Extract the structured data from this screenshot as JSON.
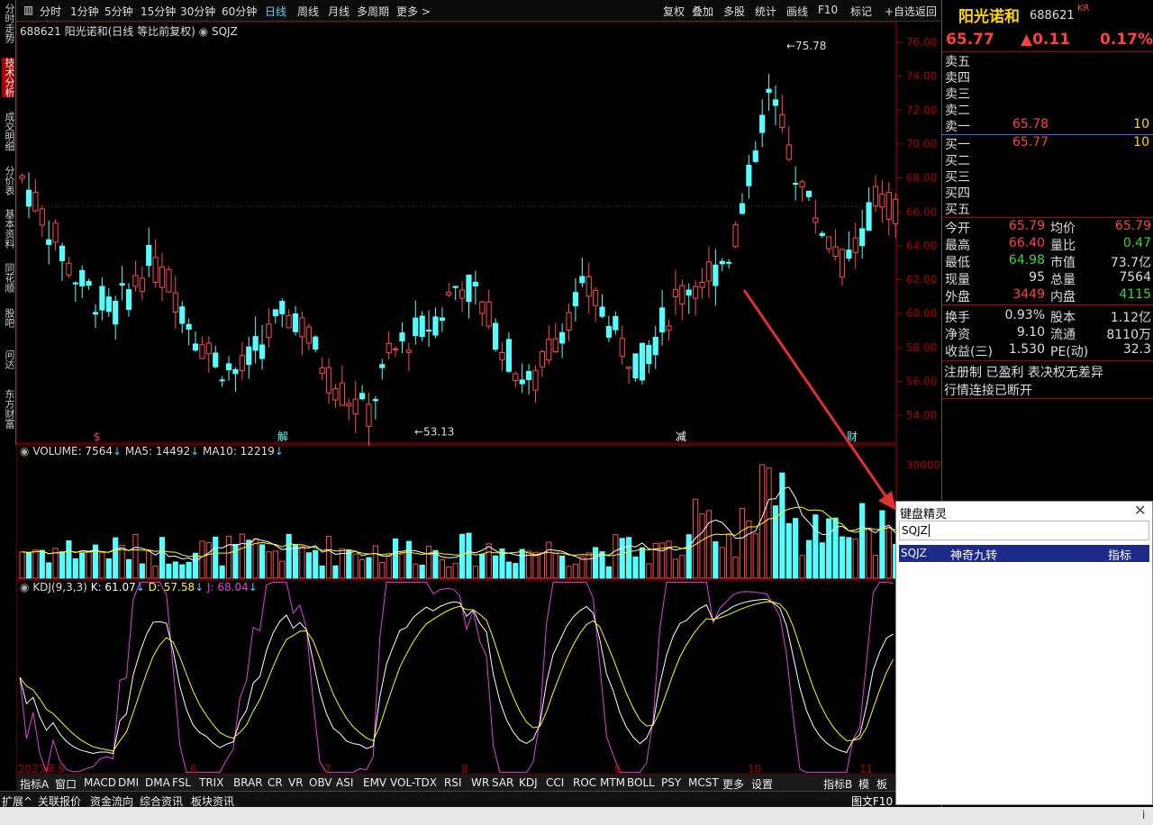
{
  "toolbar": {
    "left": [
      "分时",
      "1分钟",
      "5分钟",
      "15分钟",
      "30分钟",
      "60分钟",
      "日线",
      "周线",
      "月线",
      "多周期",
      "更多 >"
    ],
    "right": [
      "复权",
      "叠加",
      "多股",
      "统计",
      "画线",
      "F10",
      "标记",
      "+自选",
      "返回"
    ]
  },
  "leftnav": [
    "分时走势",
    "技术分析",
    "成交明细",
    "分价表",
    "基本资料",
    "同花顺",
    "股吧",
    "问达",
    "东方财富"
  ],
  "chart_header": {
    "code_name": "688621 阳光诺和(日线 等比前复权)",
    "indicator": "SQJZ"
  },
  "price_axis": [
    "76.00",
    "74.00",
    "72.00",
    "70.00",
    "68.00",
    "66.00",
    "64.00",
    "62.00",
    "60.00",
    "58.00",
    "56.00",
    "54.00"
  ],
  "price_annotations": {
    "high": "75.78",
    "low": "53.13"
  },
  "event_marks": [
    "$",
    "解",
    "减",
    "财"
  ],
  "volume_header": {
    "label": "VOLUME: 7564",
    "ma5": "MA5: 14492",
    "ma10": "MA10: 12219"
  },
  "volume_axis": [
    "30000"
  ],
  "kdj_header": {
    "label": "KDJ(9,3,3)",
    "k": "K: 61.07",
    "d": "D: 57.58",
    "j": "J: 68.04"
  },
  "date_axis": [
    "2023年",
    "5",
    "6",
    "7",
    "8",
    "9",
    "10",
    "11"
  ],
  "bottom_tabs": [
    "指标A",
    "窗口",
    "MACD",
    "DMI",
    "DMA",
    "FSL",
    "TRIX",
    "BRAR",
    "CR",
    "VR",
    "OBV",
    "ASI",
    "EMV",
    "VOL-TDX",
    "RSI",
    "WR",
    "SAR",
    "KDJ",
    "CCI",
    "ROC",
    "MTM",
    "BOLL",
    "PSY",
    "MCST",
    "更多",
    "设置",
    "指标B",
    "模",
    "板"
  ],
  "bottom_bar": [
    "扩展^",
    "关联报价",
    "资金流向",
    "综合资讯",
    "板块资讯"
  ],
  "bottom_right": "图文F10",
  "quote": {
    "name": "阳光诺和",
    "code": "688621",
    "badge": "KR",
    "price": "65.77",
    "change": "▲0.11",
    "pct": "0.17%",
    "sells": [
      {
        "label": "卖五",
        "price": "",
        "vol": ""
      },
      {
        "label": "卖四",
        "price": "",
        "vol": ""
      },
      {
        "label": "卖三",
        "price": "",
        "vol": ""
      },
      {
        "label": "卖二",
        "price": "",
        "vol": ""
      },
      {
        "label": "卖一",
        "price": "65.78",
        "vol": "10"
      }
    ],
    "buys": [
      {
        "label": "买一",
        "price": "65.77",
        "vol": "10"
      },
      {
        "label": "买二",
        "price": "",
        "vol": ""
      },
      {
        "label": "买三",
        "price": "",
        "vol": ""
      },
      {
        "label": "买四",
        "price": "",
        "vol": ""
      },
      {
        "label": "买五",
        "price": "",
        "vol": ""
      }
    ],
    "stats": [
      {
        "l1": "今开",
        "v1": "65.79",
        "l2": "均价",
        "v2": "65.79"
      },
      {
        "l1": "最高",
        "v1": "66.40",
        "l2": "量比",
        "v2": "0.47"
      },
      {
        "l1": "最低",
        "v1": "64.98",
        "l2": "市值",
        "v2": "73.7亿"
      },
      {
        "l1": "现量",
        "v1": "95",
        "l2": "总量",
        "v2": "7564"
      },
      {
        "l1": "外盘",
        "v1": "3449",
        "l2": "内盘",
        "v2": "4115"
      },
      {
        "l1": "换手",
        "v1": "0.93%",
        "l2": "股本",
        "v2": "1.12亿"
      },
      {
        "l1": "净资",
        "v1": "9.10",
        "l2": "流通",
        "v2": "8110万"
      },
      {
        "l1": "收益(三)",
        "v1": "1.530",
        "l2": "PE(动)",
        "v2": "32.3"
      }
    ],
    "notes": [
      "注册制 已盈利 表决权无差异",
      "行情连接已断开"
    ]
  },
  "wizard": {
    "title": "键盘精灵",
    "input": "SQJZ",
    "result": {
      "code": "SQJZ",
      "name": "神奇九转",
      "type": "指标"
    }
  }
}
